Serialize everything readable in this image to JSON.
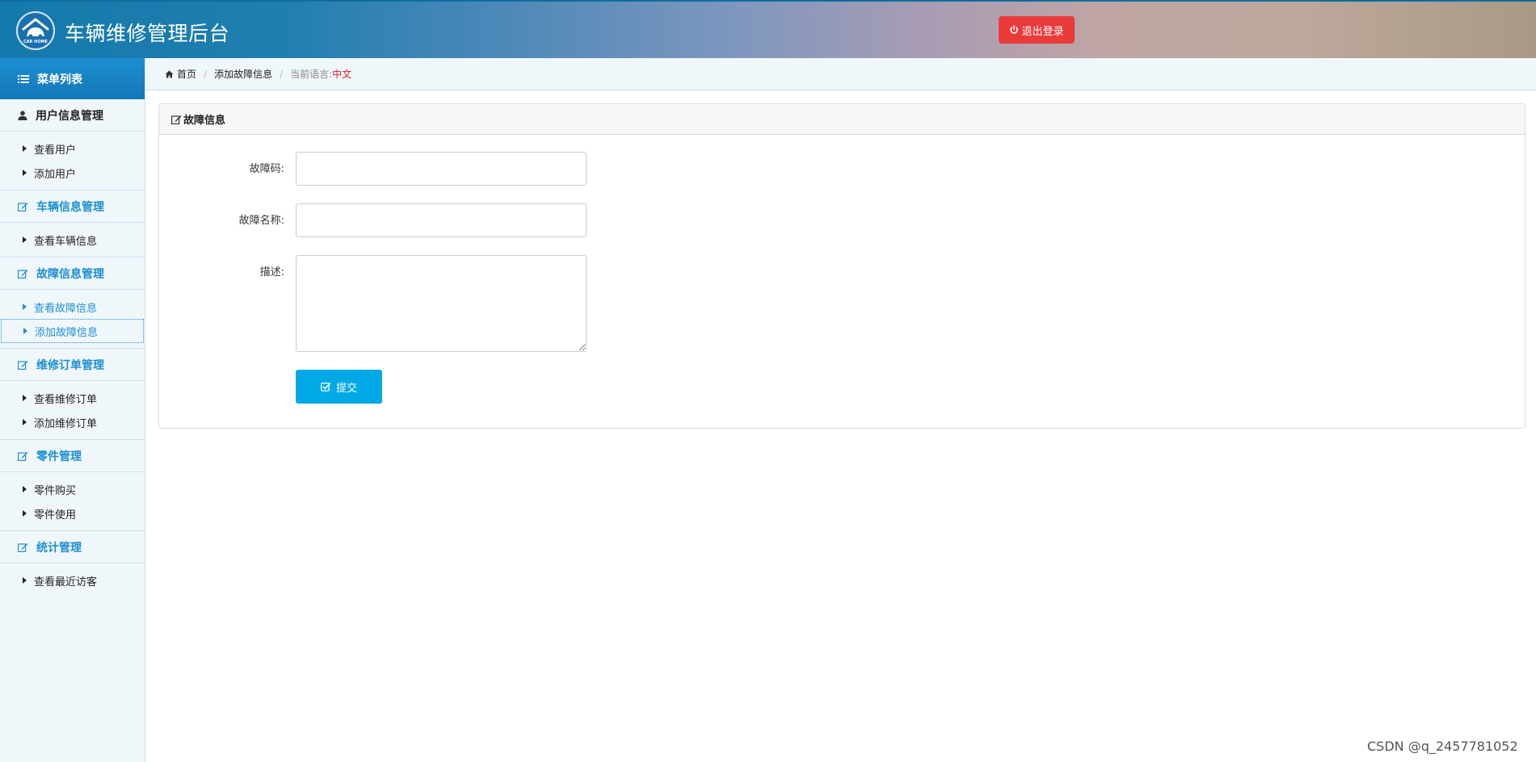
{
  "header": {
    "logo_text": "CAR HOME",
    "title": "车辆维修管理后台",
    "logout_label": "退出登录"
  },
  "sidebar": {
    "heading": "菜单列表",
    "groups": [
      {
        "title": "用户信息管理",
        "icon": "user-icon",
        "items": [
          "查看用户",
          "添加用户"
        ]
      },
      {
        "title": "车辆信息管理",
        "icon": "edit-icon",
        "items": [
          "查看车辆信息"
        ]
      },
      {
        "title": "故障信息管理",
        "icon": "edit-icon",
        "items": [
          "查看故障信息",
          "添加故障信息"
        ]
      },
      {
        "title": "维修订单管理",
        "icon": "edit-icon",
        "items": [
          "查看维修订单",
          "添加维修订单"
        ]
      },
      {
        "title": "零件管理",
        "icon": "edit-icon",
        "items": [
          "零件购买",
          "零件使用"
        ]
      },
      {
        "title": "统计管理",
        "icon": "edit-icon",
        "items": [
          "查看最近访客"
        ]
      }
    ]
  },
  "breadcrumb": {
    "home": "首页",
    "current": "添加故障信息",
    "lang_label": "当前语言:",
    "lang_value": "中文"
  },
  "panel": {
    "title": "故障信息",
    "fields": {
      "code_label": "故障码:",
      "code_value": "",
      "name_label": "故障名称:",
      "name_value": "",
      "desc_label": "描述:",
      "desc_value": ""
    },
    "submit_label": "提交"
  },
  "watermark": "CSDN @q_2457781052",
  "colors": {
    "accent": "#1d8fd0",
    "logout": "#ea3b3b",
    "submit": "#00a8e6",
    "language": "#e02020"
  }
}
